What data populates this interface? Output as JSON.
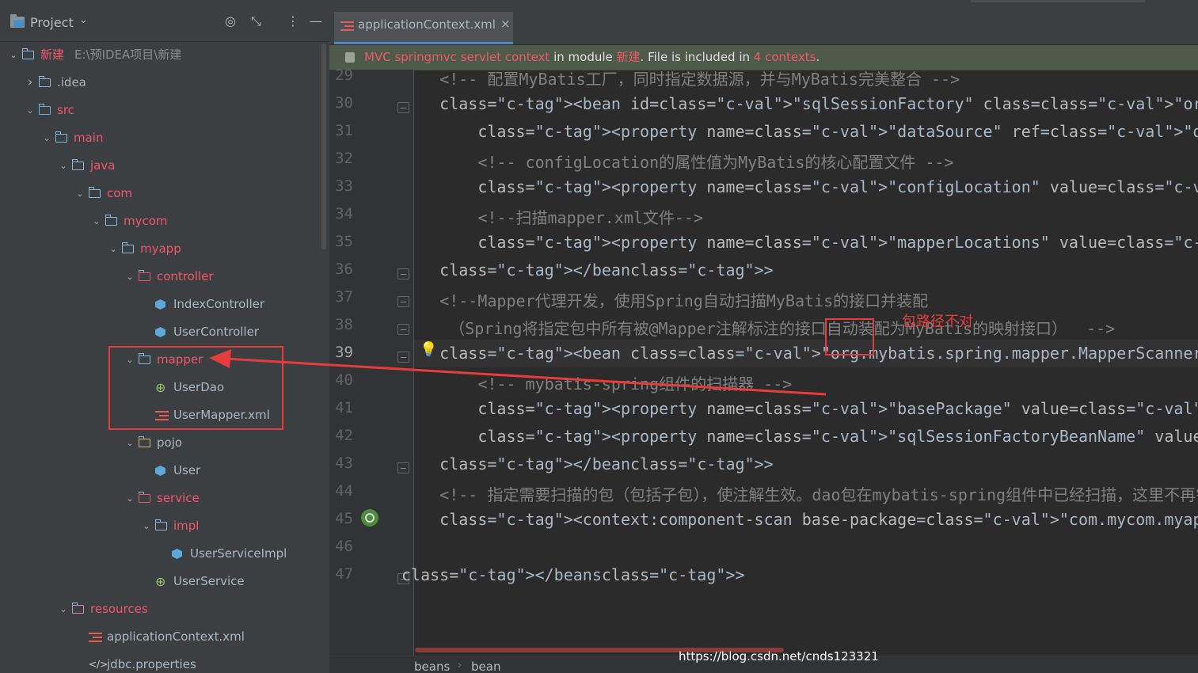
{
  "project_panel": {
    "title": "Project",
    "tree": [
      {
        "label": "新建",
        "path": "E:\\预IDEA项目\\新建",
        "level": 0,
        "expanded": true,
        "icon": "folder-icon"
      },
      {
        "label": ".idea",
        "level": 1,
        "expanded": false,
        "icon": "folder-icon"
      },
      {
        "label": "src",
        "level": 1,
        "expanded": true,
        "icon": "source-folder-icon"
      },
      {
        "label": "main",
        "level": 2,
        "expanded": true,
        "icon": "folder-icon"
      },
      {
        "label": "java",
        "level": 3,
        "expanded": true,
        "icon": "folder-icon"
      },
      {
        "label": "com",
        "level": 4,
        "expanded": true,
        "icon": "package-icon"
      },
      {
        "label": "mycom",
        "level": 5,
        "expanded": true,
        "icon": "package-icon"
      },
      {
        "label": "myapp",
        "level": 6,
        "expanded": true,
        "icon": "package-icon"
      },
      {
        "label": "controller",
        "level": 7,
        "expanded": true,
        "icon": "package-icon"
      },
      {
        "label": "IndexController",
        "level": 8,
        "icon": "class-icon"
      },
      {
        "label": "UserController",
        "level": 8,
        "icon": "class-icon"
      },
      {
        "label": "mapper",
        "level": 7,
        "expanded": true,
        "icon": "package-icon"
      },
      {
        "label": "UserDao",
        "level": 8,
        "icon": "interface-icon"
      },
      {
        "label": "UserMapper.xml",
        "level": 8,
        "icon": "xml-file-icon"
      },
      {
        "label": "pojo",
        "level": 7,
        "expanded": true,
        "icon": "package-icon"
      },
      {
        "label": "User",
        "level": 8,
        "icon": "class-icon"
      },
      {
        "label": "service",
        "level": 7,
        "expanded": true,
        "icon": "package-icon"
      },
      {
        "label": "impl",
        "level": 8,
        "expanded": true,
        "icon": "package-icon"
      },
      {
        "label": "UserServiceImpl",
        "level": 9,
        "icon": "class-icon"
      },
      {
        "label": "UserService",
        "level": 8,
        "icon": "interface-icon"
      },
      {
        "label": "resources",
        "level": 3,
        "expanded": true,
        "icon": "resources-folder-icon"
      },
      {
        "label": "applicationContext.xml",
        "level": 4,
        "icon": "xml-file-icon"
      },
      {
        "label": "jdbc.properties",
        "level": 4,
        "icon": "properties-file-icon"
      }
    ]
  },
  "editor": {
    "tab": {
      "label": "applicationContext.xml",
      "close": "×"
    },
    "notice": {
      "ctx": "MVC springmvc servlet context",
      "mid": " in module ",
      "module": "新建",
      "mid2": ". File is included in ",
      "count": "4 contexts",
      "end": "."
    },
    "current_line": 39,
    "lines": [
      {
        "n": "29",
        "text": "    <!-- 配置MyBatis工厂，同时指定数据源，并与MyBatis完美整合 -->"
      },
      {
        "n": "30",
        "text": "    <bean id=\"sqlSessionFactory\" class=\"org.mybatis.spring.SqlSessionFactoryBean\">"
      },
      {
        "n": "31",
        "text": "        <property name=\"dataSource\" ref=\"dataSource\" />"
      },
      {
        "n": "32",
        "text": "        <!-- configLocation的属性值为MyBatis的核心配置文件 -->"
      },
      {
        "n": "33",
        "text": "        <property name=\"configLocation\" value=\"classpath:mybatis-config.xml\"/>"
      },
      {
        "n": "34",
        "text": "        <!--扫描mapper.xml文件-->"
      },
      {
        "n": "35",
        "text": "        <property name=\"mapperLocations\" value=\"classpath:com/mycom/myapp/mapper/*.xml\"/>"
      },
      {
        "n": "36",
        "text": "    </bean>"
      },
      {
        "n": "37",
        "text": "    <!--Mapper代理开发，使用Spring自动扫描MyBatis的接口并装配"
      },
      {
        "n": "38",
        "text": "     （Spring将指定包中所有被@Mapper注解标注的接口自动装配为MyBatis的映射接口）  -->"
      },
      {
        "n": "39",
        "text": "    <bean class=\"org.mybatis.spring.mapper.MapperScannerConfigurer\">"
      },
      {
        "n": "40",
        "text": "        <!-- mybatis-spring组件的扫描器 -->"
      },
      {
        "n": "41",
        "text": "        <property name=\"basePackage\" value=\"dao\"/>"
      },
      {
        "n": "42",
        "text": "        <property name=\"sqlSessionFactoryBeanName\" value=\"sqlSessionFactory\"/>"
      },
      {
        "n": "43",
        "text": "    </bean>"
      },
      {
        "n": "44",
        "text": "    <!-- 指定需要扫描的包（包括子包），使注解生效。dao包在mybatis-spring组件中已经扫描，这里不再需要扫描-->"
      },
      {
        "n": "45",
        "text": "    <context:component-scan base-package=\"com.mycom.myapp.service.impl\"/>"
      },
      {
        "n": "46",
        "text": ""
      },
      {
        "n": "47",
        "text": "</beans>"
      }
    ],
    "annotation_note": "包路径不对",
    "breadcrumb": [
      "beans",
      "bean"
    ]
  },
  "watermark": "https://blog.csdn.net/cnds123321",
  "colors": {
    "accent_red": "#e63c3c",
    "tag": "#e8bf6a",
    "value": "#6a8759",
    "comment": "#808080"
  }
}
